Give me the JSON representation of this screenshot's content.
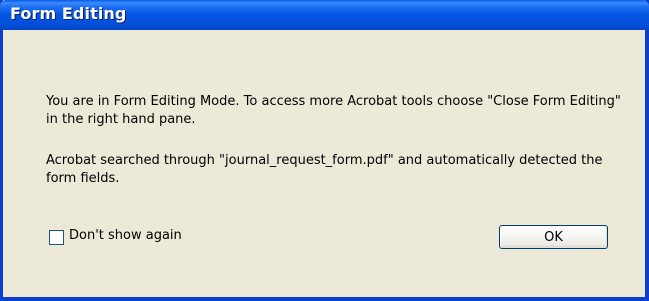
{
  "window": {
    "title": "Form Editing"
  },
  "message": {
    "line1": "You are in Form Editing Mode. To access more Acrobat tools choose \"Close Form Editing\" in the right hand pane.",
    "line2": "Acrobat searched through \"journal_request_form.pdf\" and automatically detected the form fields."
  },
  "checkbox": {
    "label": "Don't show again",
    "checked": false
  },
  "buttons": {
    "ok_label": "OK"
  },
  "colors": {
    "titlebar": "#0554e3",
    "frame": "#0a3fd1",
    "dialog_bg": "#ece9d8"
  }
}
